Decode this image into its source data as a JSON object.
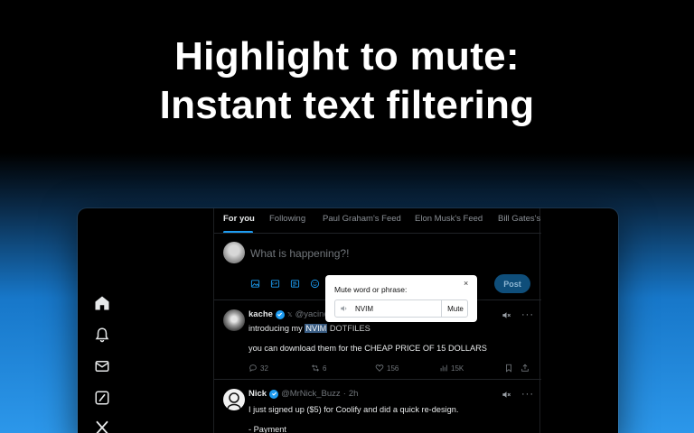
{
  "headline": {
    "line1": "Highlight to mute:",
    "line2": "Instant text filtering"
  },
  "tabs": [
    {
      "label": "For you",
      "active": true
    },
    {
      "label": "Following",
      "active": false
    },
    {
      "label": "Paul Graham's Feed",
      "active": false
    },
    {
      "label": "Elon Musk's Feed",
      "active": false
    },
    {
      "label": "Bill Gates's",
      "active": false
    }
  ],
  "compose": {
    "placeholder": "What is happening?!",
    "post_label": "Post"
  },
  "sidebar": {
    "icons": [
      "home-icon",
      "bell-icon",
      "mail-icon",
      "grok-icon",
      "x-logo-icon"
    ]
  },
  "popup": {
    "label": "Mute word or phrase:",
    "close": "×",
    "value": "NVIM",
    "mute_label": "Mute"
  },
  "tweets": [
    {
      "name": "kache",
      "handle": "@yacine",
      "line1_before": "introducing my ",
      "line1_highlight": "NVIM",
      "line1_after": " DOTFILES",
      "line2": "you can download them for the CHEAP PRICE OF 15 DOLLARS",
      "replies": "32",
      "reposts": "6",
      "likes": "156",
      "views": "15K"
    },
    {
      "name": "Nick",
      "handle": "@MrNick_Buzz",
      "time": "2h",
      "line1": "I just signed up ($5) for Coolify and did a quick re-design.",
      "line2": "- Payment"
    }
  ],
  "colors": {
    "accent": "#1d9bf0",
    "highlight": "#3b5f86",
    "gradient_bottom": "#2c97ea"
  }
}
